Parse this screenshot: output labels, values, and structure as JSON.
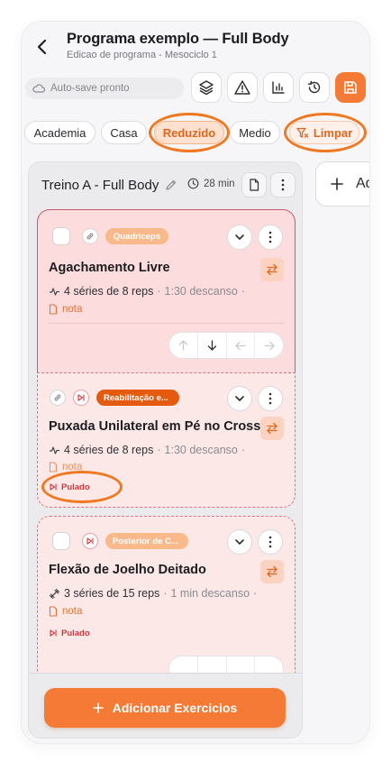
{
  "header": {
    "title": "Programa exemplo — Full Body",
    "subtitle": "Edicao de programa - Mesociclo 1"
  },
  "toolbar": {
    "autosave_label": "Auto-save pronto",
    "icons": [
      "layers-icon",
      "warning-icon",
      "bar-chart-icon",
      "history-icon",
      "save-icon"
    ]
  },
  "filters": {
    "chips": [
      "Academia",
      "Casa",
      "Reduzido",
      "Medio"
    ],
    "selected": "Reduzido",
    "clear_label": "Limpar"
  },
  "workout": {
    "name": "Treino A - Full Body",
    "duration": "28 min",
    "exercises": [
      {
        "tag": "Quadriceps",
        "tag_color": "#f9b98b",
        "name": "Agachamento Livre",
        "sets": "4 séries de 8 reps",
        "rest": "1:30 descanso",
        "note": "nota"
      },
      {
        "tag": "Reabilitação e...",
        "tag_color": "#e45a0f",
        "name": "Puxada Unilateral em Pé no Cross",
        "sets": "4 séries de 8 reps",
        "rest": "1:30 descanso",
        "note": "nota",
        "status": "Pulado"
      },
      {
        "tag": "Posterior de C...",
        "tag_color": "#f9b98b",
        "name": "Flexão de Joelho Deitado",
        "sets": "3 séries de 15 reps",
        "rest": "1 min descanso",
        "note": "nota",
        "status": "Pulado"
      }
    ],
    "add_button_label": "Adicionar Exercicios"
  },
  "next_column": {
    "label": "Ad"
  },
  "colors": {
    "accent": "#f47a35",
    "highlight_ring": "#ef7820",
    "skipped": "#d2353a"
  }
}
